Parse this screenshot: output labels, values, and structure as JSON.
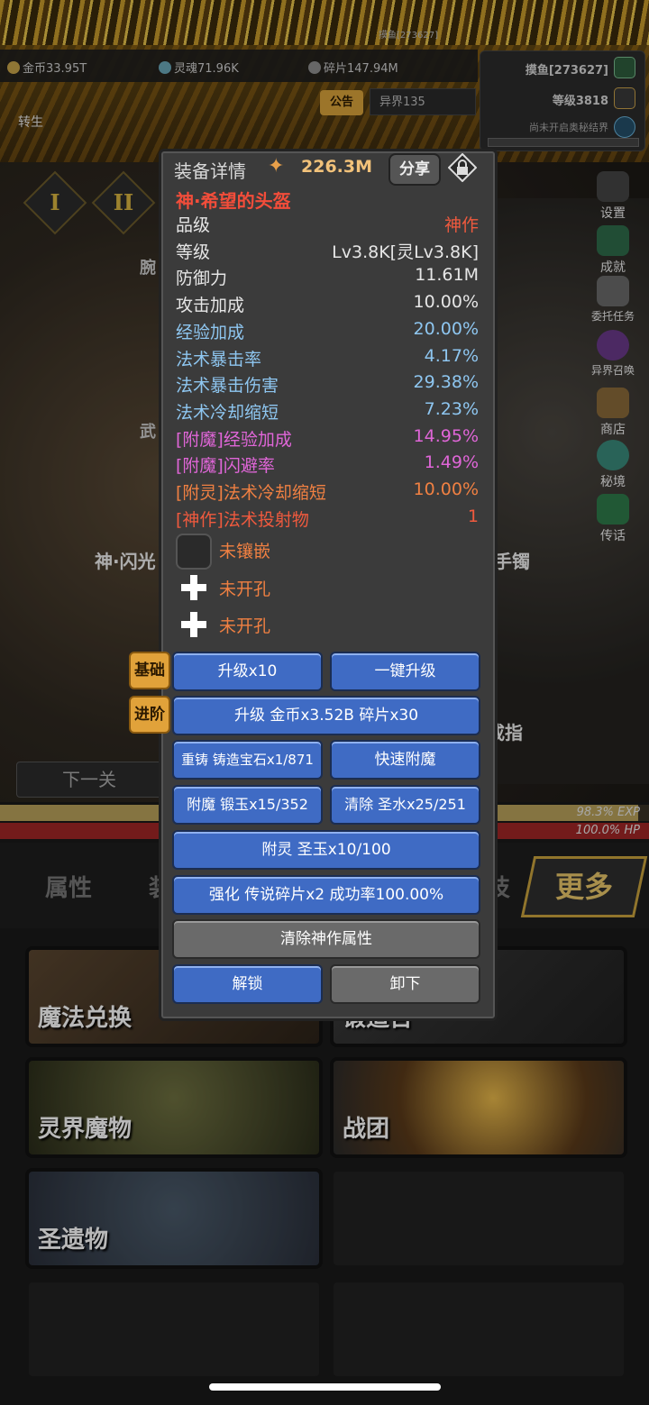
{
  "top": {
    "name_small": "摸鱼[273627]",
    "resources": [
      {
        "icon": "gold-coin-icon",
        "label": "金币33.95T"
      },
      {
        "icon": "soul-icon",
        "label": "灵魂71.96K"
      },
      {
        "icon": "shard-icon",
        "label": "碎片147.94M"
      }
    ],
    "player_name": "摸鱼[273627]",
    "player_level": "等级3818",
    "secret_realm": "尚未开启奥秘结界",
    "notice": "公告",
    "other_world": "异界135",
    "reborn": "转生"
  },
  "scene": {
    "roman_tabs": [
      "I",
      "II"
    ],
    "side_menu": [
      "设置",
      "成就",
      "委托任务",
      "异界召唤",
      "商店",
      "秘境",
      "传话"
    ],
    "labels": {
      "left_weapon": "神·闪光",
      "right_bracelet": "手镯",
      "right_ring": "戒指",
      "partial_wrist": "腕",
      "partial_weapon": "武"
    },
    "next_stage": "下一关"
  },
  "bars": {
    "exp_text": "98.3% EXP",
    "exp_fraction": 0.983,
    "hp_text": "100.0% HP",
    "hp_fraction": 1.0
  },
  "bottom": {
    "tabs": [
      "属性",
      "装",
      "技"
    ],
    "more": "更多",
    "cards": [
      "魔法兑换",
      "锻造台",
      "灵界魔物",
      "战团",
      "圣遗物"
    ]
  },
  "popup": {
    "title": "装备详情",
    "power": "226.3M",
    "share": "分享",
    "item_name": "神·希望的头盔",
    "stats": [
      {
        "k": "品级",
        "v": "神作",
        "color": "#e6e6e6",
        "vcolor": "#f05a3e"
      },
      {
        "k": "等级",
        "v": "Lv3.8K[灵Lv3.8K]",
        "color": "#e6e6e6",
        "vcolor": "#e6e6e6"
      },
      {
        "k": "防御力",
        "v": "11.61M",
        "color": "#e6e6e6",
        "vcolor": "#e6e6e6"
      },
      {
        "k": "攻击加成",
        "v": "10.00%",
        "color": "#e6e6e6",
        "vcolor": "#e6e6e6"
      },
      {
        "k": "经验加成",
        "v": "20.00%",
        "color": "#8ec6f0",
        "vcolor": "#8ec6f0"
      },
      {
        "k": "法术暴击率",
        "v": "4.17%",
        "color": "#8ec6f0",
        "vcolor": "#8ec6f0"
      },
      {
        "k": "法术暴击伤害",
        "v": "29.38%",
        "color": "#8ec6f0",
        "vcolor": "#8ec6f0"
      },
      {
        "k": "法术冷却缩短",
        "v": "7.23%",
        "color": "#8ec6f0",
        "vcolor": "#8ec6f0"
      },
      {
        "k": "[附魔]经验加成",
        "v": "14.95%",
        "color": "#e066d8",
        "vcolor": "#e066d8"
      },
      {
        "k": "[附魔]闪避率",
        "v": "1.49%",
        "color": "#e066d8",
        "vcolor": "#e066d8"
      },
      {
        "k": "[附灵]法术冷却缩短",
        "v": "10.00%",
        "color": "#f08042",
        "vcolor": "#f08042"
      },
      {
        "k": "[神作]法术投射物",
        "v": "1",
        "color": "#f05a3e",
        "vcolor": "#f05a3e"
      }
    ],
    "sockets": [
      "未镶嵌",
      "未开孔",
      "未开孔"
    ],
    "tag_basic": "基础",
    "tag_advanced": "进阶",
    "buttons": {
      "upgrade10": "升级x10",
      "one_click": "一键升级",
      "upgrade_cost": "升级 金币x3.52B 碎片x30",
      "recast": "重铸 铸造宝石x1/871",
      "quick_enchant": "快速附魔",
      "enchant": "附魔 锻玉x15/352",
      "clear": "清除 圣水x25/251",
      "spirit": "附灵 圣玉x10/100",
      "strengthen": "强化 传说碎片x2 成功率100.00%",
      "clear_divine": "清除神作属性",
      "unlock": "解锁",
      "unequip": "卸下"
    }
  }
}
